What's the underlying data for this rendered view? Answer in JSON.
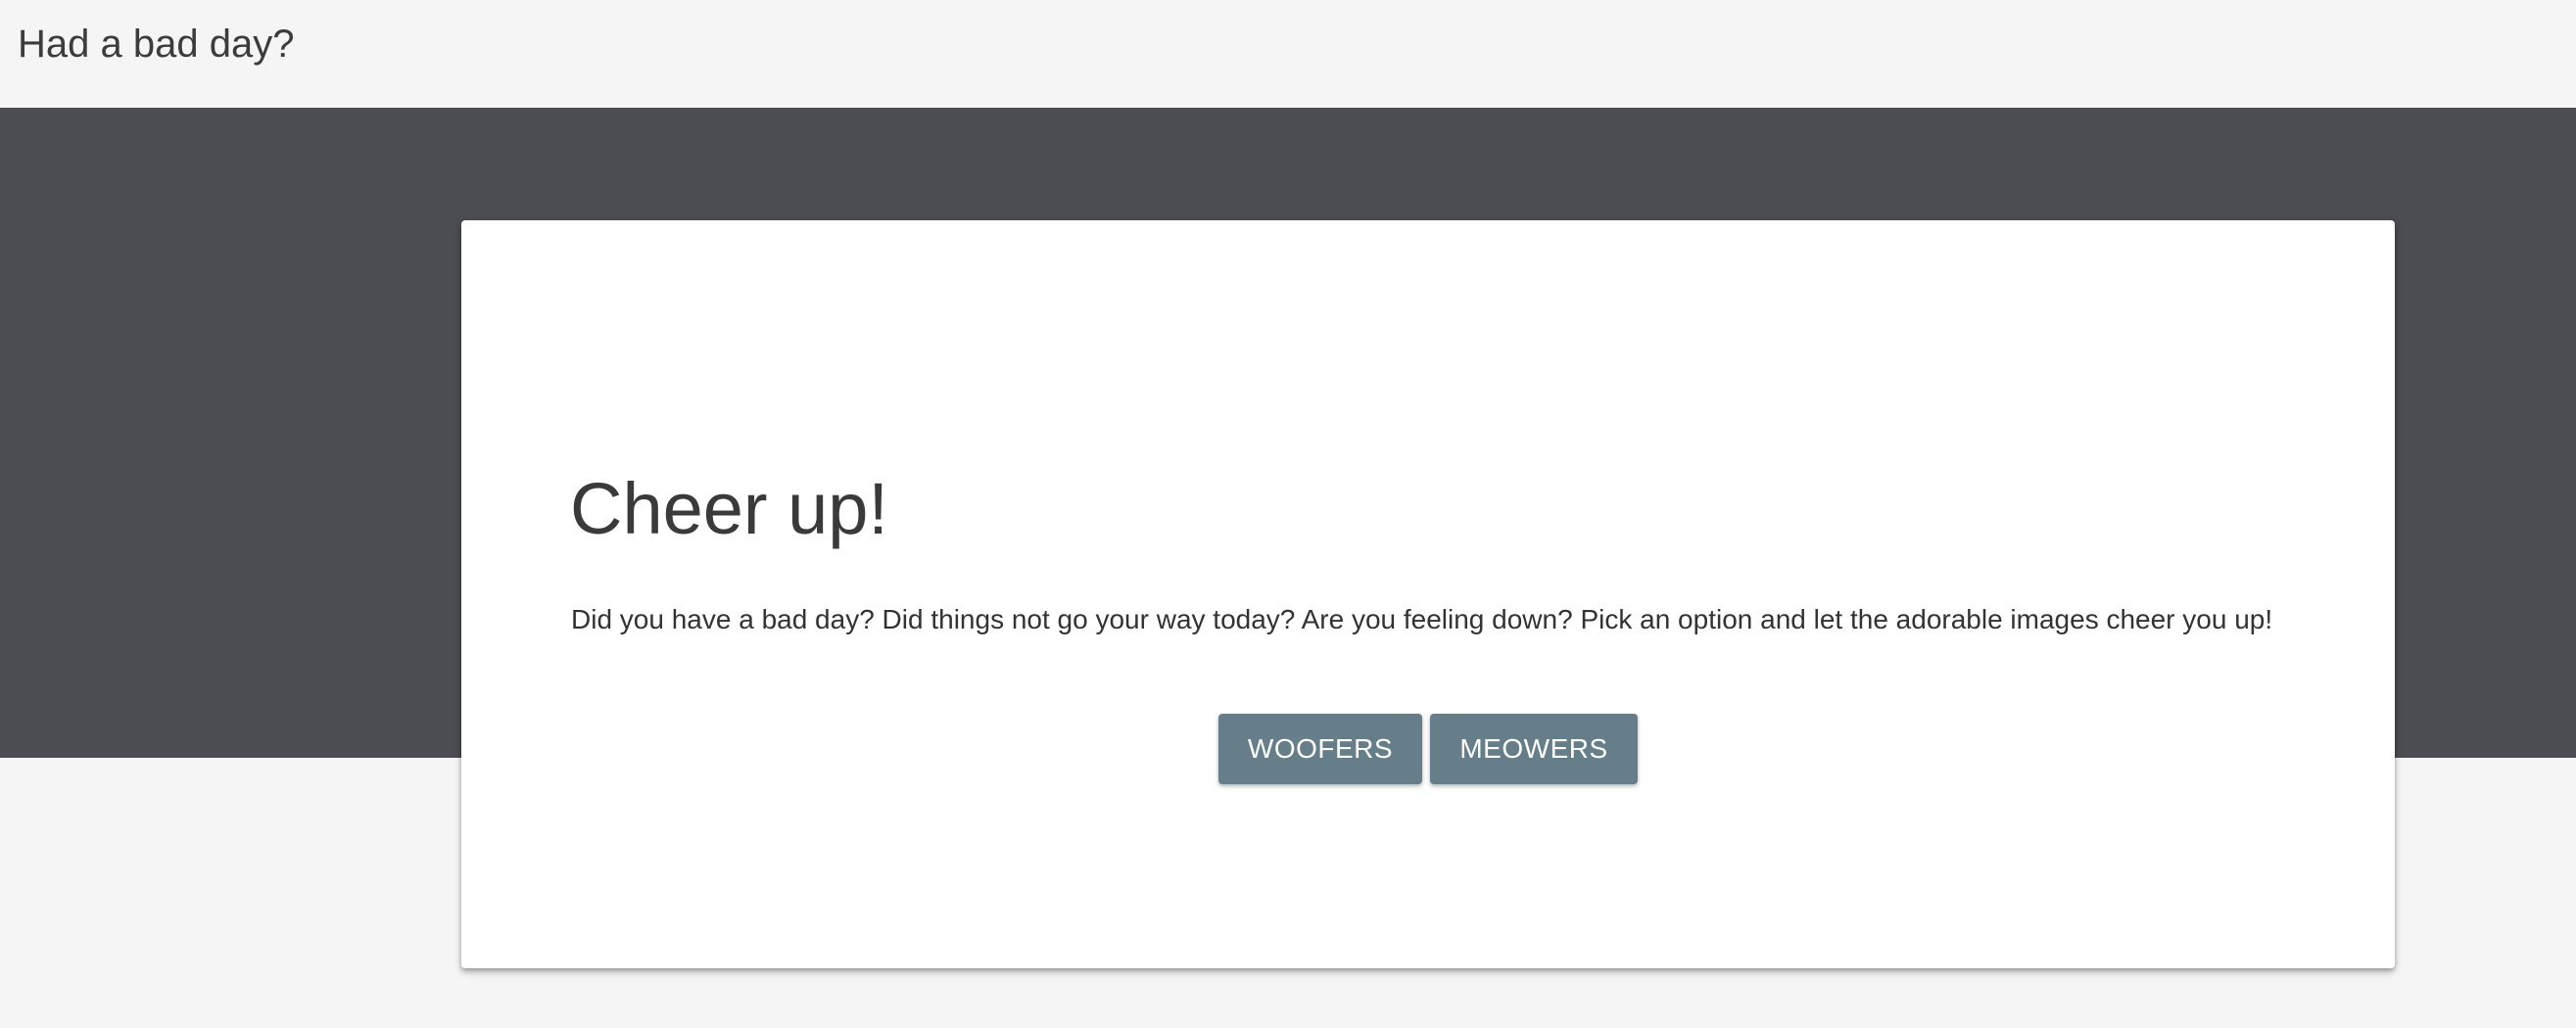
{
  "header": {
    "title": "Had a bad day?"
  },
  "card": {
    "title": "Cheer up!",
    "text": "Did you have a bad day? Did things not go your way today? Are you feeling down? Pick an option and let the adorable images cheer you up!",
    "buttons": {
      "woofers": "WOOFERS",
      "meowers": "MEOWERS"
    }
  },
  "colors": {
    "background": "#f5f5f5",
    "hero_band": "#4b4d52",
    "card": "#ffffff",
    "button": "#667d8a",
    "button_text": "#ffffff",
    "heading_text": "#3a3a3a"
  }
}
